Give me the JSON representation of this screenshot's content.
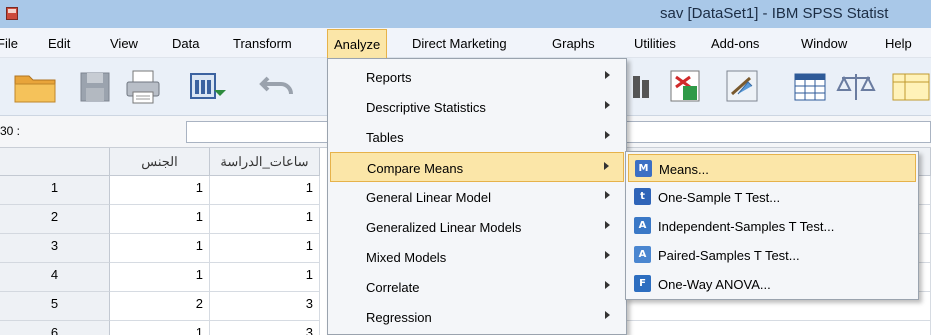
{
  "window": {
    "title": "sav [DataSet1] - IBM SPSS Statist"
  },
  "menubar": {
    "items": [
      {
        "label": "File",
        "key": "file"
      },
      {
        "label": "Edit",
        "key": "edit"
      },
      {
        "label": "View",
        "key": "view"
      },
      {
        "label": "Data",
        "key": "data"
      },
      {
        "label": "Transform",
        "key": "transform"
      },
      {
        "label": "Analyze",
        "key": "analyze"
      },
      {
        "label": "Direct Marketing",
        "key": "direct-marketing"
      },
      {
        "label": "Graphs",
        "key": "graphs"
      },
      {
        "label": "Utilities",
        "key": "utilities"
      },
      {
        "label": "Add-ons",
        "key": "add-ons"
      },
      {
        "label": "Window",
        "key": "window"
      },
      {
        "label": "Help",
        "key": "help"
      }
    ]
  },
  "toolbar": {
    "icons": [
      "open-folder-icon",
      "save-icon",
      "print-icon",
      "dialog-recall-icon",
      "undo-icon",
      "find-icon",
      "split-file-icon",
      "weight-cases-icon",
      "value-labels-icon",
      "balance-scale-icon",
      "table-icon"
    ]
  },
  "cell_ref": {
    "label": "30 :"
  },
  "grid": {
    "columns": [
      "الجنس",
      "ساعات_الدراسة"
    ],
    "rows": [
      {
        "num": "1",
        "values": [
          "1",
          "1"
        ]
      },
      {
        "num": "2",
        "values": [
          "1",
          "1"
        ]
      },
      {
        "num": "3",
        "values": [
          "1",
          "1"
        ]
      },
      {
        "num": "4",
        "values": [
          "1",
          "1"
        ]
      },
      {
        "num": "5",
        "values": [
          "2",
          "3"
        ]
      },
      {
        "num": "6",
        "values": [
          "1",
          "3"
        ]
      }
    ]
  },
  "analyze_menu": {
    "items": [
      {
        "label": "Reports",
        "has_submenu": true
      },
      {
        "label": "Descriptive Statistics",
        "has_submenu": true
      },
      {
        "label": "Tables",
        "has_submenu": true
      },
      {
        "label": "Compare Means",
        "has_submenu": true,
        "active": true
      },
      {
        "label": "General Linear Model",
        "has_submenu": true
      },
      {
        "label": "Generalized Linear Models",
        "has_submenu": true
      },
      {
        "label": "Mixed Models",
        "has_submenu": true
      },
      {
        "label": "Correlate",
        "has_submenu": true
      },
      {
        "label": "Regression",
        "has_submenu": true
      }
    ]
  },
  "compare_means_menu": {
    "items": [
      {
        "label": "Means...",
        "icon": "means-icon",
        "glyph": "M",
        "color": "#3b6fc4",
        "active": true
      },
      {
        "label": "One-Sample T Test...",
        "icon": "one-sample-t-icon",
        "glyph": "t",
        "color": "#2f64b8"
      },
      {
        "label": "Independent-Samples T Test...",
        "icon": "independent-t-icon",
        "glyph": "A",
        "color": "#3a78c6"
      },
      {
        "label": "Paired-Samples T Test...",
        "icon": "paired-t-icon",
        "glyph": "A",
        "color": "#4a86d0"
      },
      {
        "label": "One-Way ANOVA...",
        "icon": "anova-icon",
        "glyph": "F",
        "color": "#2d6ec0"
      }
    ]
  },
  "colors": {
    "highlight": "#fbe6a8",
    "highlight_border": "#e6b24a",
    "titlebar": "#a9c8e8"
  }
}
